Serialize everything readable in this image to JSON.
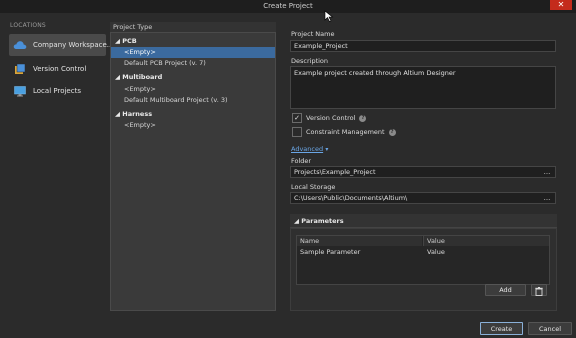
{
  "window": {
    "title": "Create Project"
  },
  "locations": {
    "header": "LOCATIONS",
    "items": [
      {
        "label": "Company Workspace...",
        "icon": "cloud-icon"
      },
      {
        "label": "Version Control",
        "icon": "version-control-icon"
      },
      {
        "label": "Local Projects",
        "icon": "monitor-icon"
      }
    ]
  },
  "project_type": {
    "header": "Project Type",
    "groups": [
      {
        "label": "PCB",
        "items": [
          "<Empty>",
          "Default PCB Project (v. 7)"
        ]
      },
      {
        "label": "Multiboard",
        "items": [
          "<Empty>",
          "Default Multiboard Project (v. 3)"
        ]
      },
      {
        "label": "Harness",
        "items": [
          "<Empty>"
        ]
      }
    ],
    "selected": "PCB / <Empty>"
  },
  "form": {
    "name_label": "Project Name",
    "name_value": "Example_Project",
    "description_label": "Description",
    "description_value": "Example project created through Altium Designer",
    "version_control_label": "Version Control",
    "version_control_checked": true,
    "constraint_label": "Constraint Management",
    "constraint_checked": false,
    "advanced_label": "Advanced",
    "folder_label": "Folder",
    "folder_value": "Projects\\Example_Project",
    "local_storage_label": "Local Storage",
    "local_storage_value": "C:\\Users\\Public\\Documents\\Altium\\",
    "browse_label": "...",
    "check_mark": "✓",
    "help_mark": "?"
  },
  "parameters": {
    "header": "Parameters",
    "columns": [
      "Name",
      "Value"
    ],
    "rows": [
      {
        "name": "Sample Parameter",
        "value": "Value"
      }
    ],
    "add_label": "Add"
  },
  "footer": {
    "create_label": "Create",
    "cancel_label": "Cancel"
  },
  "colors": {
    "accent": "#3b6a9e",
    "close": "#c42b1c",
    "link": "#6aa6e6"
  }
}
